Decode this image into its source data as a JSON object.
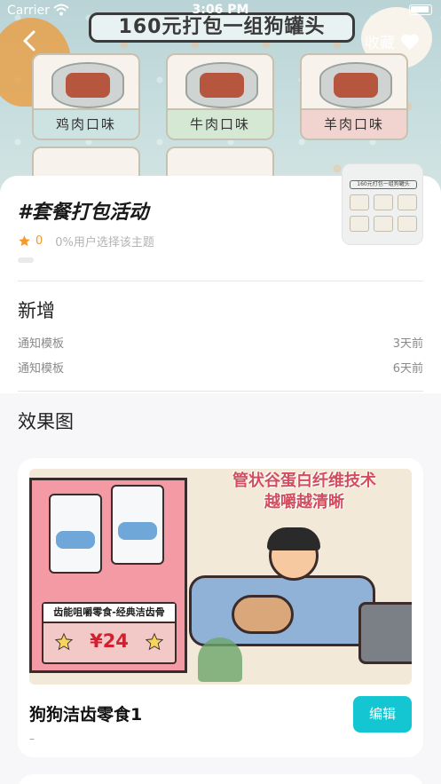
{
  "status_bar": {
    "carrier": "Carrier",
    "time": "3:06 PM"
  },
  "header": {
    "favorite_label": "收藏"
  },
  "banner": {
    "title": "160元打包一组狗罐头",
    "cans": [
      "鸡肉口味",
      "牛肉口味",
      "羊肉口味"
    ]
  },
  "topic": {
    "title": "#套餐打包活动",
    "rating_count": "0",
    "selection_text": "0%用户选择该主题"
  },
  "thumbnail": {
    "title": "160元打包一组狗罐头"
  },
  "updates": {
    "heading": "新增",
    "items": [
      {
        "label": "通知模板",
        "when": "3天前"
      },
      {
        "label": "通知模板",
        "when": "6天前"
      }
    ]
  },
  "effects": {
    "heading": "效果图",
    "card": {
      "headline_line1": "管状谷蛋白纤维技术",
      "headline_line2": "越嚼越清晰",
      "price_caption": "齿能咀嚼零食-经典洁齿骨",
      "price": "¥24",
      "product_name": "狗狗洁齿零食1",
      "subtitle": "–",
      "edit_label": "编辑"
    }
  },
  "colors": {
    "accent": "#14c6d2",
    "star": "#f39a2b",
    "muted_text": "#8a8a8a"
  }
}
